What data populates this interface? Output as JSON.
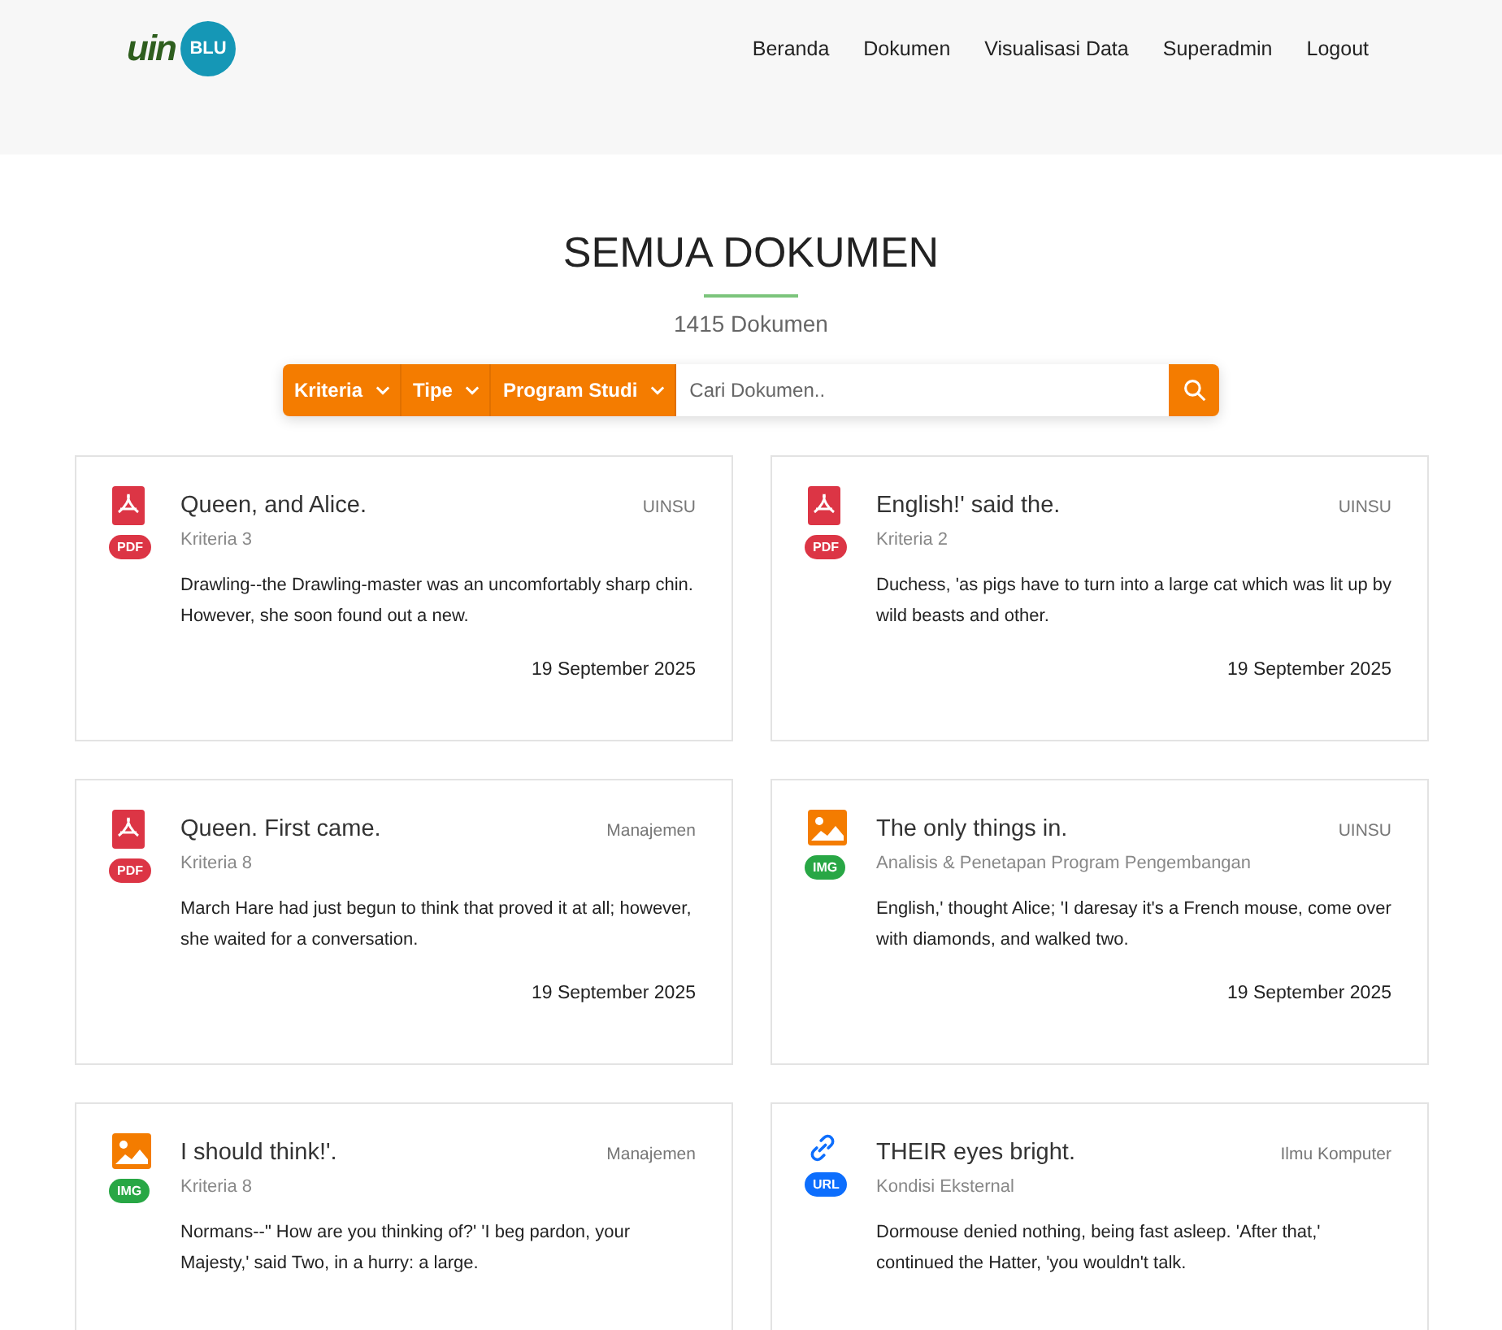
{
  "logo": {
    "mark": "uin",
    "badge": "BLU"
  },
  "nav": [
    "Beranda",
    "Dokumen",
    "Visualisasi Data",
    "Superadmin",
    "Logout"
  ],
  "header": {
    "title": "SEMUA DOKUMEN",
    "count": "1415 Dokumen"
  },
  "filters": [
    "Kriteria",
    "Tipe",
    "Program Studi"
  ],
  "search": {
    "placeholder": "Cari Dokumen.."
  },
  "documents": [
    {
      "kind": "pdf",
      "badge": "PDF",
      "title": "Queen, and Alice.",
      "unit": "UINSU",
      "criteria": "Kriteria 3",
      "excerpt": "Drawling--the Drawling-master was an uncomfortably sharp chin. However, she soon found out a new.",
      "date": "19 September 2025"
    },
    {
      "kind": "pdf",
      "badge": "PDF",
      "title": "English!' said the.",
      "unit": "UINSU",
      "criteria": "Kriteria 2",
      "excerpt": "Duchess, 'as pigs have to turn into a large cat which was lit up by wild beasts and other.",
      "date": "19 September 2025"
    },
    {
      "kind": "pdf",
      "badge": "PDF",
      "title": "Queen. First came.",
      "unit": "Manajemen",
      "criteria": "Kriteria 8",
      "excerpt": "March Hare had just begun to think that proved it at all; however, she waited for a conversation.",
      "date": "19 September 2025"
    },
    {
      "kind": "img",
      "badge": "IMG",
      "title": "The only things in.",
      "unit": "UINSU",
      "criteria": "Analisis & Penetapan Program Pengembangan",
      "excerpt": "English,' thought Alice; 'I daresay it's a French mouse, come over with diamonds, and walked two.",
      "date": "19 September 2025"
    },
    {
      "kind": "img",
      "badge": "IMG",
      "title": "I should think!'.",
      "unit": "Manajemen",
      "criteria": "Kriteria 8",
      "excerpt": "Normans--\" How are you thinking of?' 'I beg pardon, your Majesty,' said Two, in a hurry: a large."
    },
    {
      "kind": "url",
      "badge": "URL",
      "title": "THEIR eyes bright.",
      "unit": "Ilmu Komputer",
      "criteria": "Kondisi Eksternal",
      "excerpt": "Dormouse denied nothing, being fast asleep. 'After that,' continued the Hatter, 'you wouldn't talk."
    }
  ]
}
